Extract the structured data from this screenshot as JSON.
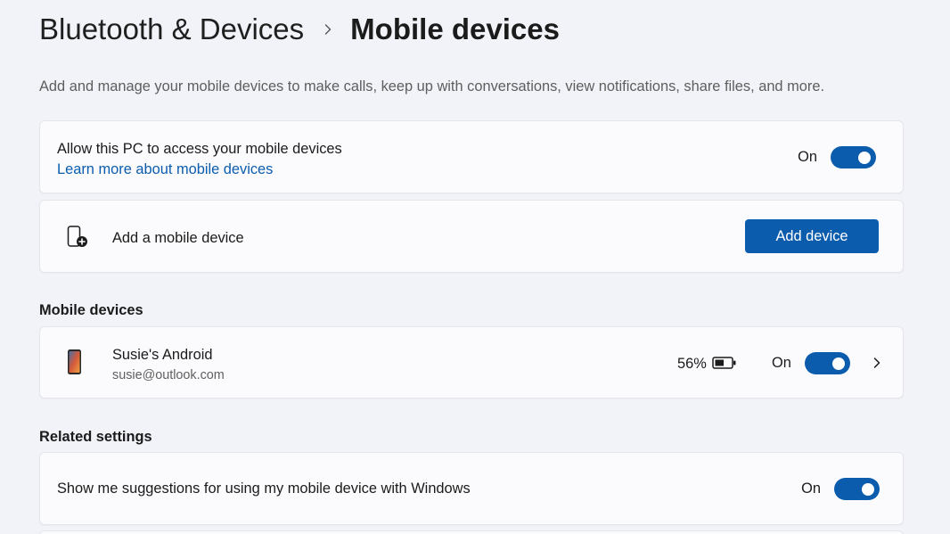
{
  "header": {
    "parent": "Bluetooth & Devices",
    "separator_icon": "chevron-right-icon",
    "current": "Mobile devices"
  },
  "description": "Add and manage your mobile devices to make calls, keep up with conversations, view notifications, share files, and more.",
  "access_card": {
    "title": "Allow this PC to access your mobile devices",
    "link": "Learn more about mobile devices",
    "toggle_state": "On"
  },
  "add_card": {
    "icon": "add-phone-icon",
    "label": "Add a mobile device",
    "button": "Add device"
  },
  "mobile_devices": {
    "heading": "Mobile devices",
    "device": {
      "icon": "android-phone-icon",
      "name": "Susie's Android",
      "account": "susie@outlook.com",
      "battery": "56%",
      "battery_level": 0.56,
      "battery_icon": "battery-icon",
      "toggle_state": "On",
      "chevron_icon": "chevron-right-icon"
    }
  },
  "related": {
    "heading": "Related settings",
    "suggestions": {
      "label": "Show me suggestions for using my mobile device with Windows",
      "toggle_state": "On"
    }
  },
  "colors": {
    "accent": "#0b5cad",
    "background": "#f1f3f8",
    "card": "#fbfbfd"
  }
}
